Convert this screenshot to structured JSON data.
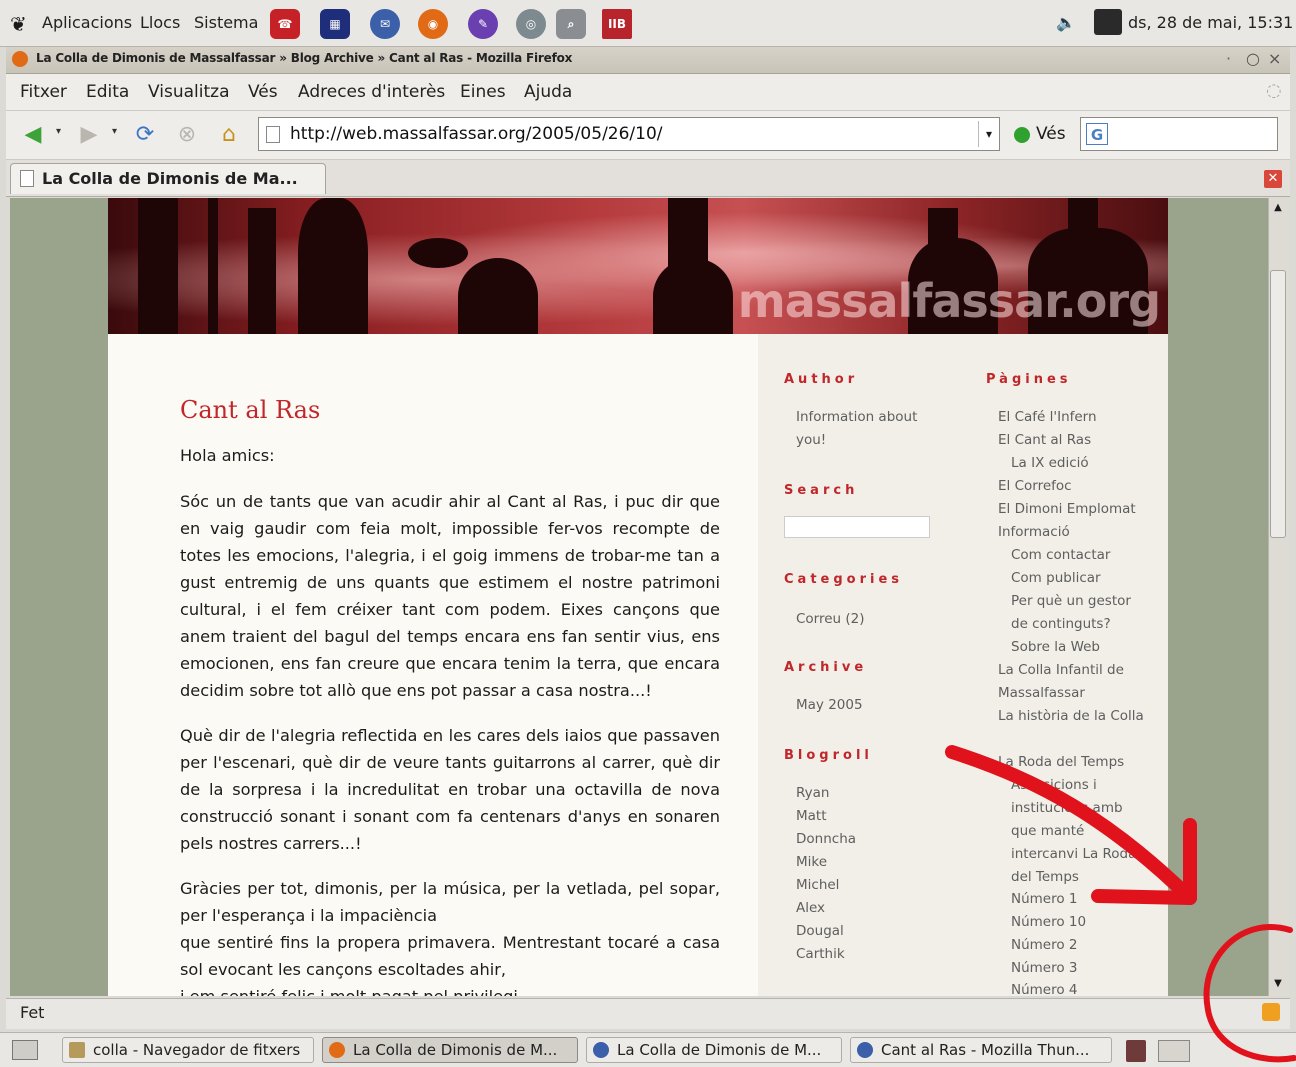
{
  "panel": {
    "menus": [
      "Aplicacions",
      "Llocs",
      "Sistema"
    ],
    "clock": "ds, 28 de mai, 15:31"
  },
  "window": {
    "title": "La Colla de Dimonis de Massalfassar » Blog Archive » Cant al Ras - Mozilla Firefox"
  },
  "menubar": [
    "Fitxer",
    "Edita",
    "Visualitza",
    "Vés",
    "Adreces d'interès",
    "Eines",
    "Ajuda"
  ],
  "navbar": {
    "url": "http://web.massalfassar.org/2005/05/26/10/",
    "go_label": "Vés",
    "search_value": ""
  },
  "tab": {
    "label": "La Colla de Dimonis de Ma..."
  },
  "page": {
    "banner_text": "massalfassar.org",
    "post_title": "Cant al Ras",
    "paragraphs": [
      "Hola amics:",
      "Sóc un de tants que van acudir ahir al Cant al Ras, i puc dir que en vaig gaudir com feia molt, impossible fer-vos recompte de totes les emocions, l'alegria, i el goig immens de trobar-me tan a gust entremig de uns quants que estimem el nostre patrimoni cultural, i el fem créixer tant com podem. Eixes cançons que anem traient del bagul del temps encara ens fan sentir vius, ens emocionen, ens fan creure que encara tenim la terra, que encara decidim sobre tot allò que ens pot passar a casa nostra...!",
      "Què dir de l'alegria reflectida en les cares dels iaios que passaven per l'escenari, què dir de veure tants guitarrons al carrer, què dir de la sorpresa i la incredulitat en trobar una octavilla de nova construcció sonant i sonant com fa centenars d'anys en sonaren pels nostres carrers...!",
      "Gràcies per tot, dimonis, per la música, per la vetlada, pel sopar, per l'esperança i la impaciència",
      "que sentiré fins la propera primavera. Mentrestant tocaré a casa sol evocant les cançons escoltades ahir,",
      "i em sentiré feliç i molt pagat pel privilegi..."
    ],
    "sidebar": {
      "author_heading": "Author",
      "author_text": "Information about you!",
      "search_heading": "Search",
      "categories_heading": "Categories",
      "categories": [
        "Correu (2)"
      ],
      "archive_heading": "Archive",
      "archive": [
        "May 2005"
      ],
      "blogroll_heading": "Blogroll",
      "blogroll": [
        "Ryan",
        "Matt",
        "Donncha",
        "Mike",
        "Michel",
        "Alex",
        "Dougal",
        "Carthik"
      ],
      "pages_heading": "Pàgines",
      "pages": [
        {
          "label": "El Café l'Infern",
          "indent": 0
        },
        {
          "label": "El Cant al Ras",
          "indent": 0
        },
        {
          "label": "La IX edició",
          "indent": 1
        },
        {
          "label": "El Correfoc",
          "indent": 0
        },
        {
          "label": "El Dimoni Emplomat",
          "indent": 0
        },
        {
          "label": "Informació",
          "indent": 0
        },
        {
          "label": "Com contactar",
          "indent": 1
        },
        {
          "label": "Com publicar",
          "indent": 1
        },
        {
          "label": "Per què un gestor de continguts?",
          "indent": 1
        },
        {
          "label": "Sobre la Web",
          "indent": 1
        },
        {
          "label": "La Colla Infantil de Massalfassar",
          "indent": 0
        },
        {
          "label": "La història de la Colla",
          "indent": 0
        },
        {
          "label": "La Roda del Temps",
          "indent": 0
        },
        {
          "label": "Associcions i institucions amb que manté intercanvi La Roda del Temps",
          "indent": 1
        },
        {
          "label": "Número 1",
          "indent": 1
        },
        {
          "label": "Número 10",
          "indent": 1
        },
        {
          "label": "Número 2",
          "indent": 1
        },
        {
          "label": "Número 3",
          "indent": 1
        },
        {
          "label": "Número 4",
          "indent": 1
        }
      ]
    }
  },
  "status": {
    "text": "Fet"
  },
  "taskbar": [
    {
      "label": "colla - Navegador de fitxers",
      "active": false
    },
    {
      "label": "La Colla de Dimonis de M...",
      "active": true
    },
    {
      "label": "La Colla de Dimonis de M...",
      "active": false
    },
    {
      "label": "Cant al Ras - Mozilla Thun...",
      "active": false
    }
  ],
  "colors": {
    "accent_red": "#c0262a",
    "annotation_red": "#e0121b"
  }
}
